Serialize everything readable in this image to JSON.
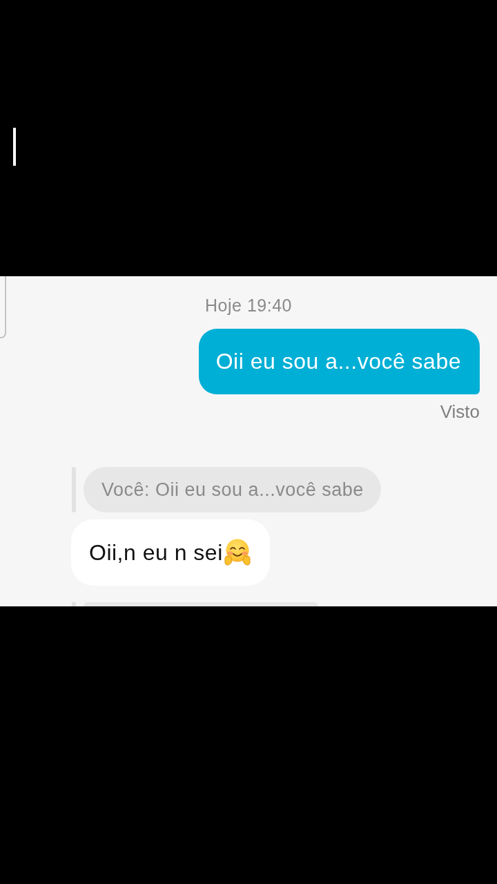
{
  "chat": {
    "timestamp": "Hoje 19:40",
    "messages": [
      {
        "kind": "sent",
        "text": "Oii eu sou a...você sabe",
        "status": "Visto"
      },
      {
        "kind": "reply",
        "quote": "Você: Oii eu sou a...você sabe",
        "text": "Oii,n eu n sei",
        "emoji": true
      }
    ]
  }
}
